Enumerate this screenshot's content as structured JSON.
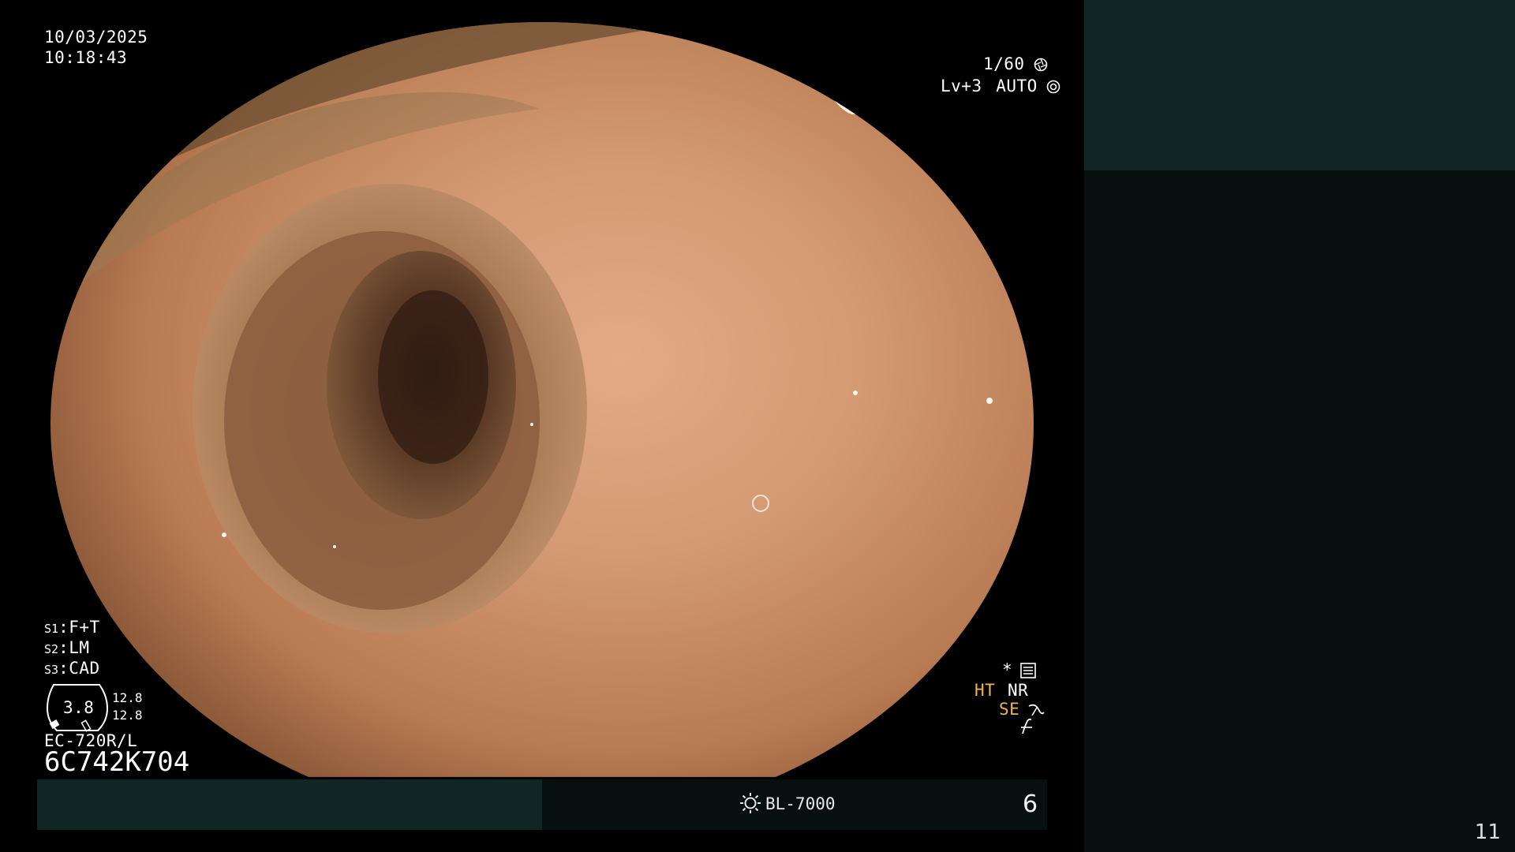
{
  "overlay": {
    "date": "10/03/2025",
    "time": "10:18:43",
    "shutter": "1/60",
    "level": "Lv+3",
    "exposure_mode": "AUTO",
    "s1_tag": "S1",
    "s1_value": ":F+T",
    "s2_tag": "S2",
    "s2_value": ":LM",
    "s3_tag": "S3",
    "s3_value": ":CAD",
    "scope_value": "3.8",
    "scope_reading_1": "12.8",
    "scope_reading_2": "12.8",
    "scope_model": "EC-720R/L",
    "scope_serial": "6C742K704",
    "asterisk": "*",
    "ht_label": "HT",
    "nr_label": "NR",
    "se_label": "SE",
    "light_source": "BL-7000",
    "bar_number": "6"
  },
  "right_panel": {
    "page_number": "11"
  },
  "colors": {
    "right_top_panel": "#0f2624",
    "right_panel": "#06110f",
    "orange_label": "#f2b450",
    "tissue_base": "#c98b62"
  },
  "icons": {
    "shutter": "shutter-aperture-icon",
    "auto_iris": "iris-icon",
    "settings": "menu-settings-icon",
    "light": "light-source-icon",
    "se_curve": "enhancement-curve-icon",
    "f_mark": "freeze-icon"
  }
}
